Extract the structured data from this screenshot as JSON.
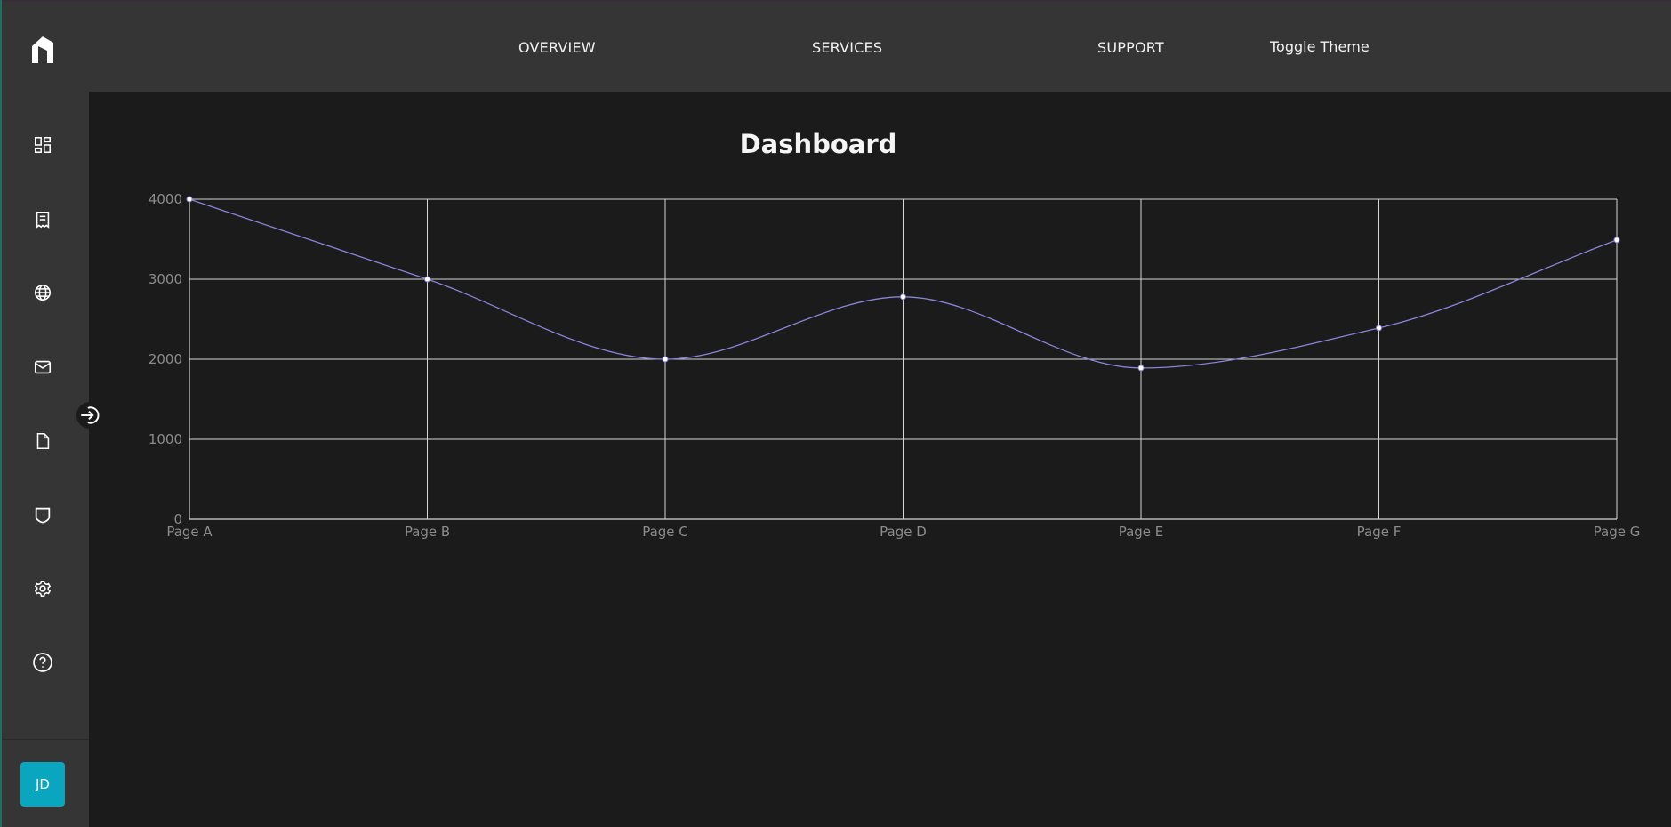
{
  "nav": {
    "links": [
      "OVERVIEW",
      "SERVICES",
      "SUPPORT"
    ],
    "toggle_theme": "Toggle Theme"
  },
  "sidebar": {
    "items": [
      {
        "icon": "dashboard-icon"
      },
      {
        "icon": "receipt-icon"
      },
      {
        "icon": "globe-icon"
      },
      {
        "icon": "mail-icon"
      },
      {
        "icon": "file-icon"
      },
      {
        "icon": "shield-icon"
      },
      {
        "icon": "settings-icon"
      },
      {
        "icon": "help-icon"
      }
    ],
    "collapse_icon": "arrow-right-circle-icon",
    "avatar_initials": "JD",
    "avatar_color": "#0aa6c0"
  },
  "page": {
    "title": "Dashboard"
  },
  "chart_data": {
    "type": "line",
    "categories": [
      "Page A",
      "Page B",
      "Page C",
      "Page D",
      "Page E",
      "Page F",
      "Page G"
    ],
    "series": [
      {
        "values": [
          4000,
          3000,
          2000,
          2780,
          1890,
          2390,
          3490
        ],
        "color": "#8884d8"
      }
    ],
    "yticks": [
      0,
      1000,
      2000,
      3000,
      4000
    ],
    "ylim": [
      0,
      4000
    ],
    "grid": true,
    "curve": "smooth"
  }
}
